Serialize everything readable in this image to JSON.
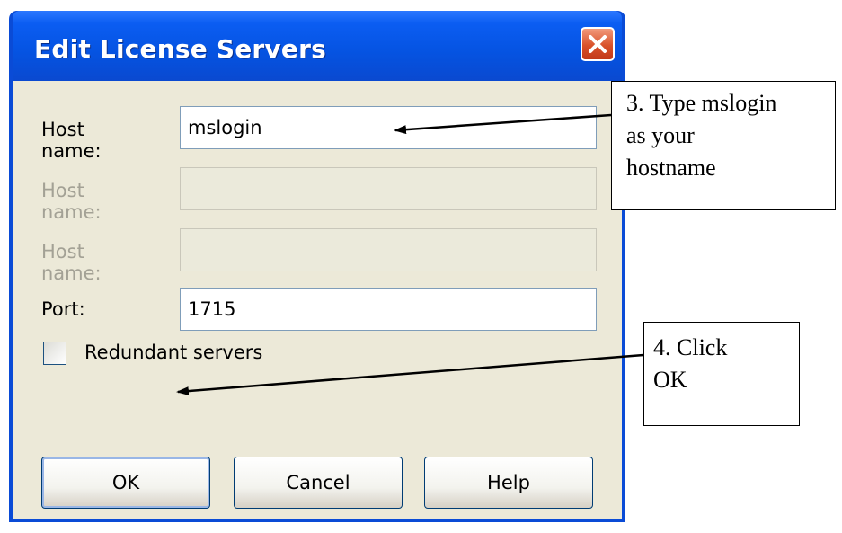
{
  "dialog": {
    "title": "Edit License Servers",
    "fields": [
      {
        "label": "Host name:",
        "value": "mslogin",
        "enabled": true
      },
      {
        "label": "Host name:",
        "value": "",
        "enabled": false
      },
      {
        "label": "Host name:",
        "value": "",
        "enabled": false
      },
      {
        "label": "Port:",
        "value": "1715",
        "enabled": true
      }
    ],
    "redundant_label": "Redundant servers",
    "redundant_checked": false,
    "buttons": {
      "ok": "OK",
      "cancel": "Cancel",
      "help": "Help"
    }
  },
  "annotations": {
    "step3": {
      "line1": "3. Type mslogin",
      "line2": "as your",
      "line3": "hostname"
    },
    "step4": {
      "line1": "4. Click",
      "line2": "OK"
    }
  },
  "colors": {
    "titlebar": "#0553e1",
    "dialog_bg": "#ece9d8",
    "close_button": "#d9512a",
    "disabled_text": "#a3a195"
  },
  "icons": {
    "close": "close-icon",
    "checkbox": "checkbox-icon"
  }
}
